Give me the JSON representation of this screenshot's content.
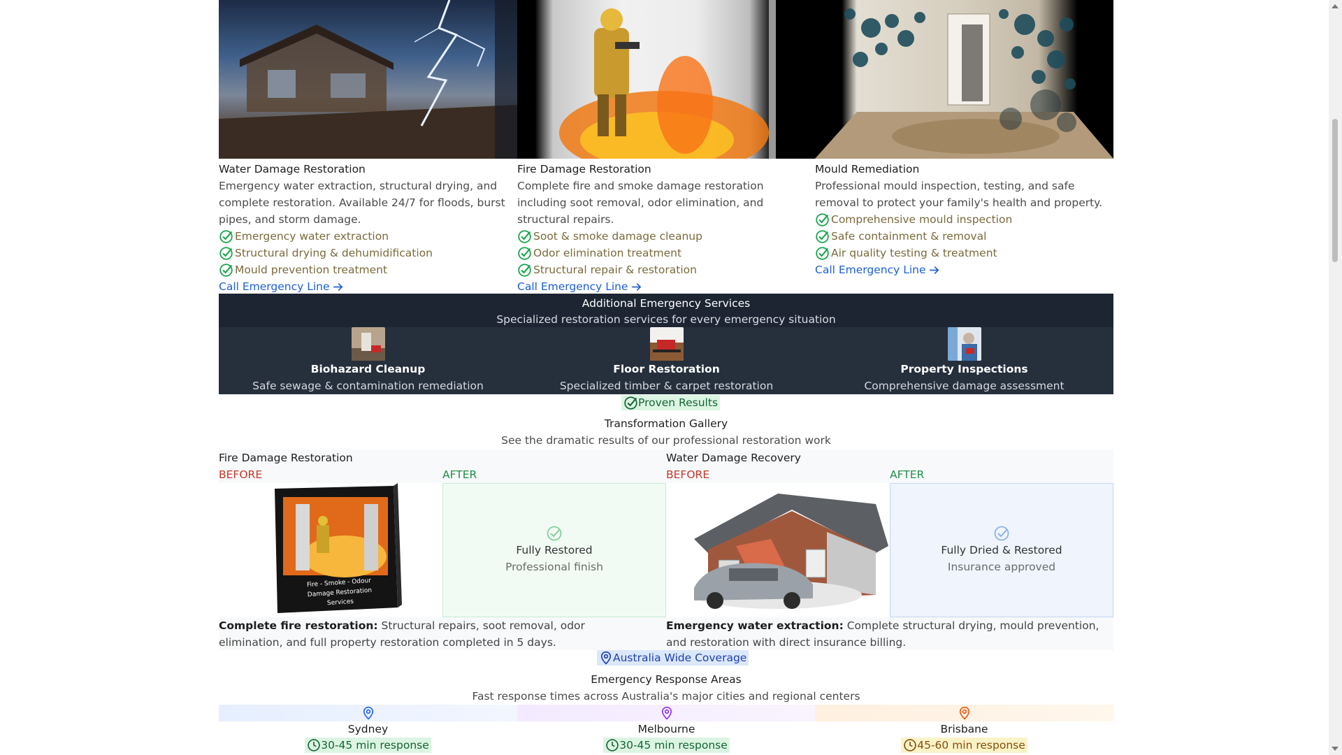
{
  "services": [
    {
      "title": "Water Damage Restoration",
      "desc": "Emergency water extraction, structural drying, and complete restoration. Available 24/7 for floods, burst pipes, and storm damage.",
      "features": [
        "Emergency water extraction",
        "Structural drying & dehumidification",
        "Mould prevention treatment"
      ],
      "link": "Call Emergency Line"
    },
    {
      "title": "Fire Damage Restoration",
      "desc": "Complete fire and smoke damage restoration including soot removal, odor elimination, and structural repairs.",
      "features": [
        "Soot & smoke damage cleanup",
        "Odor elimination treatment",
        "Structural repair & restoration"
      ],
      "link": "Call Emergency Line"
    },
    {
      "title": "Mould Remediation",
      "desc": "Professional mould inspection, testing, and safe removal to protect your family's health and property.",
      "features": [
        "Comprehensive mould inspection",
        "Safe containment & removal",
        "Air quality testing & treatment"
      ],
      "link": "Call Emergency Line"
    }
  ],
  "additional": {
    "title": "Additional Emergency Services",
    "subtitle": "Specialized restoration services for every emergency situation",
    "items": [
      {
        "name": "Biohazard Cleanup",
        "desc": "Safe sewage & contamination remediation"
      },
      {
        "name": "Floor Restoration",
        "desc": "Specialized timber & carpet restoration"
      },
      {
        "name": "Property Inspections",
        "desc": "Comprehensive damage assessment"
      }
    ]
  },
  "gallery": {
    "badge": "Proven Results",
    "title": "Transformation Gallery",
    "subtitle": "See the dramatic results of our professional restoration work",
    "items": [
      {
        "title": "Fire Damage Restoration",
        "before_label": "BEFORE",
        "after_label": "AFTER",
        "box_text": "Fire - Smoke - Odour Damage Restoration Services",
        "after_title": "Fully Restored",
        "after_sub": "Professional finish",
        "caption_bold": "Complete fire restoration:",
        "caption": " Structural repairs, soot removal, odor elimination, and full property restoration completed in 5 days."
      },
      {
        "title": "Water Damage Recovery",
        "before_label": "BEFORE",
        "after_label": "AFTER",
        "after_title": "Fully Dried & Restored",
        "after_sub": "Insurance approved",
        "caption_bold": "Emergency water extraction:",
        "caption": " Complete structural drying, mould prevention, and restoration with direct insurance billing."
      }
    ]
  },
  "coverage": {
    "badge": "Australia Wide Coverage",
    "title": "Emergency Response Areas",
    "subtitle": "Fast response times across Australia's major cities and regional centers",
    "cities": [
      {
        "name": "Sydney",
        "response": "30-45 min response"
      },
      {
        "name": "Melbourne",
        "response": "30-45 min response"
      },
      {
        "name": "Brisbane",
        "response": "45-60 min response"
      }
    ]
  },
  "colors": {
    "link": "#1d5fd6",
    "check": "#16a34a",
    "dark_panel": "#262f3c",
    "before": "#c0392b",
    "after": "#1f8f49"
  }
}
